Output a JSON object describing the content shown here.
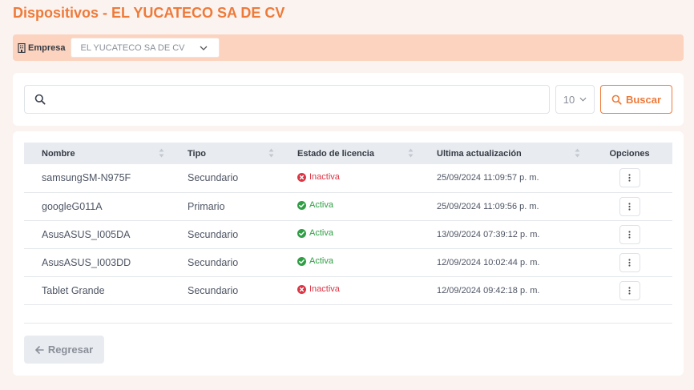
{
  "page": {
    "title": "Dispositivos - EL YUCATECO SA DE CV"
  },
  "company": {
    "label": "Empresa",
    "selected": "EL YUCATECO SA DE CV"
  },
  "search": {
    "value": "",
    "placeholder": "",
    "page_size": "10",
    "button_label": "Buscar"
  },
  "table": {
    "headers": [
      "Nombre",
      "Tipo",
      "Estado de licencia",
      "Ultima actualización",
      "Opciones"
    ],
    "rows": [
      {
        "name": "samsungSM-N975F",
        "type": "Secundario",
        "status": "Inactiva",
        "updated": "25/09/2024 11:09:57 p. m."
      },
      {
        "name": "googleG011A",
        "type": "Primario",
        "status": "Activa",
        "updated": "25/09/2024 11:09:56 p. m."
      },
      {
        "name": "AsusASUS_I005DA",
        "type": "Secundario",
        "status": "Activa",
        "updated": "13/09/2024 07:39:12 p. m."
      },
      {
        "name": "AsusASUS_I003DD",
        "type": "Secundario",
        "status": "Activa",
        "updated": "12/09/2024 10:02:44 p. m."
      },
      {
        "name": "Tablet Grande",
        "type": "Secundario",
        "status": "Inactiva",
        "updated": "12/09/2024 09:42:18 p. m."
      }
    ]
  },
  "footer": {
    "back_label": "Regresar"
  },
  "colors": {
    "accent": "#ee7a3a",
    "active": "#2f9e44",
    "inactive": "#dc3545"
  }
}
